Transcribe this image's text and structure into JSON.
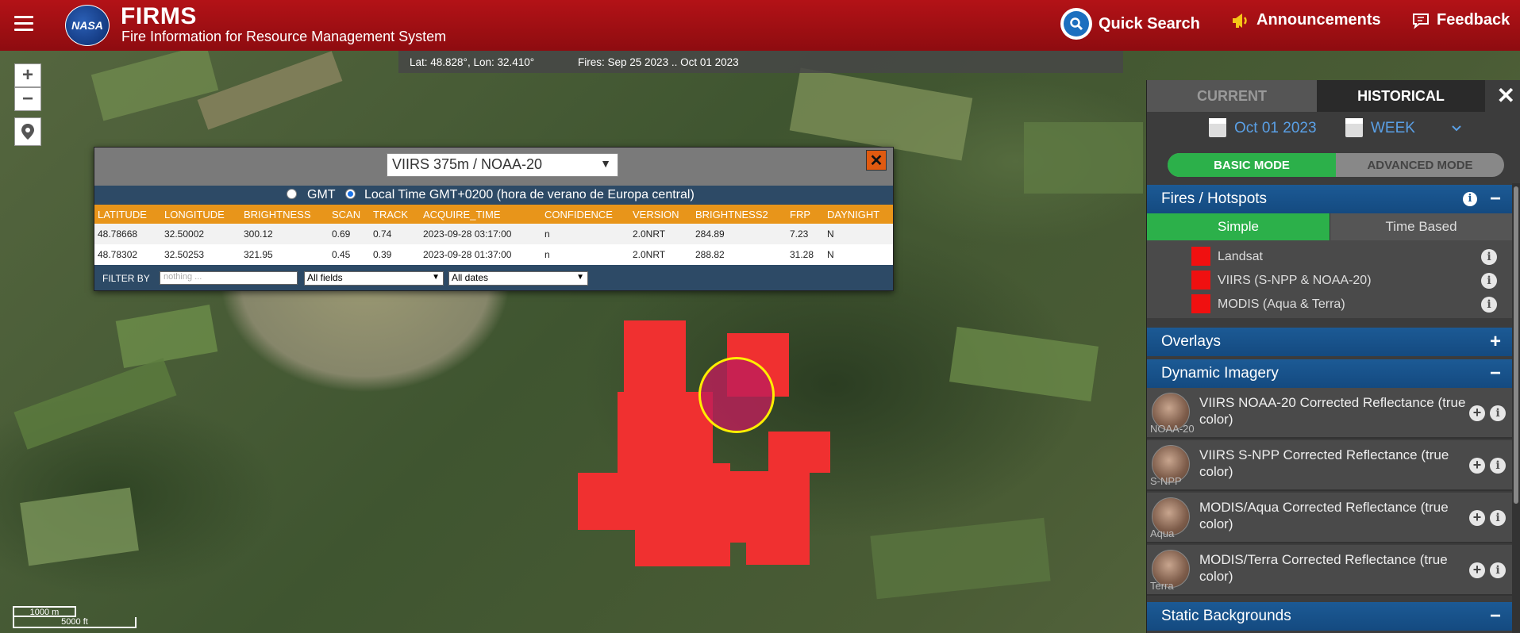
{
  "header": {
    "logo_text": "NASA",
    "title": "FIRMS",
    "subtitle": "Fire Information for Resource Management System",
    "quick_search": "Quick Search",
    "announcements": "Announcements",
    "feedback": "Feedback"
  },
  "coords": {
    "latlon": "Lat: 48.828°, Lon: 32.410°",
    "fires": "Fires: Sep 25 2023 .. Oct 01 2023"
  },
  "map_controls": {
    "zoom_in": "+",
    "zoom_out": "−"
  },
  "scale": {
    "metric": "1000 m",
    "imperial": "5000 ft"
  },
  "popup": {
    "source_select": "VIIRS 375m / NOAA-20",
    "close": "✕",
    "tz_gmt": "GMT",
    "tz_local": "Local Time GMT+0200 (hora de verano de Europa central)",
    "columns": [
      "LATITUDE",
      "LONGITUDE",
      "BRIGHTNESS",
      "SCAN",
      "TRACK",
      "ACQUIRE_TIME",
      "CONFIDENCE",
      "VERSION",
      "BRIGHTNESS2",
      "FRP",
      "DAYNIGHT"
    ],
    "rows": [
      [
        "48.78668",
        "32.50002",
        "300.12",
        "0.69",
        "0.74",
        "2023-09-28 03:17:00",
        "n",
        "2.0NRT",
        "284.89",
        "7.23",
        "N"
      ],
      [
        "48.78302",
        "32.50253",
        "321.95",
        "0.45",
        "0.39",
        "2023-09-28 01:37:00",
        "n",
        "2.0NRT",
        "288.82",
        "31.28",
        "N"
      ]
    ],
    "filter_label": "FILTER BY",
    "filter_placeholder": "nothing ...",
    "filter_fields": "All fields",
    "filter_dates": "All dates"
  },
  "panel": {
    "tab_current": "CURRENT",
    "tab_historical": "HISTORICAL",
    "close": "✕",
    "date": "Oct 01 2023",
    "period": "WEEK",
    "mode_basic": "BASIC MODE",
    "mode_advanced": "ADVANCED MODE",
    "fires_section": "Fires / Hotspots",
    "subtab_simple": "Simple",
    "subtab_time": "Time Based",
    "fire_layers": [
      "Landsat",
      "VIIRS (S-NPP & NOAA-20)",
      "MODIS (Aqua & Terra)"
    ],
    "overlays_section": "Overlays",
    "dynamic_section": "Dynamic Imagery",
    "imagery": [
      {
        "title": "VIIRS NOAA-20 Corrected Reflectance (true color)",
        "tag": "NOAA-20"
      },
      {
        "title": "VIIRS S-NPP Corrected Reflectance (true color)",
        "tag": "S-NPP"
      },
      {
        "title": "MODIS/Aqua Corrected Reflectance (true color)",
        "tag": "Aqua"
      },
      {
        "title": "MODIS/Terra Corrected Reflectance (true color)",
        "tag": "Terra"
      }
    ],
    "static_section": "Static Backgrounds",
    "info_glyph": "i",
    "plus_glyph": "+",
    "minus_glyph": "−"
  },
  "colors": {
    "header_red": "#b31217",
    "fire_red": "#f03030",
    "panel_blue": "#1c5a95",
    "active_green": "#2cb04a",
    "table_header_orange": "#e8951a"
  },
  "icons": [
    "hamburger-icon",
    "quick-search-icon",
    "megaphone-icon",
    "chat-icon",
    "location-pin-icon",
    "calendar-icon",
    "chevron-down-icon",
    "close-icon",
    "info-icon",
    "plus-icon"
  ]
}
